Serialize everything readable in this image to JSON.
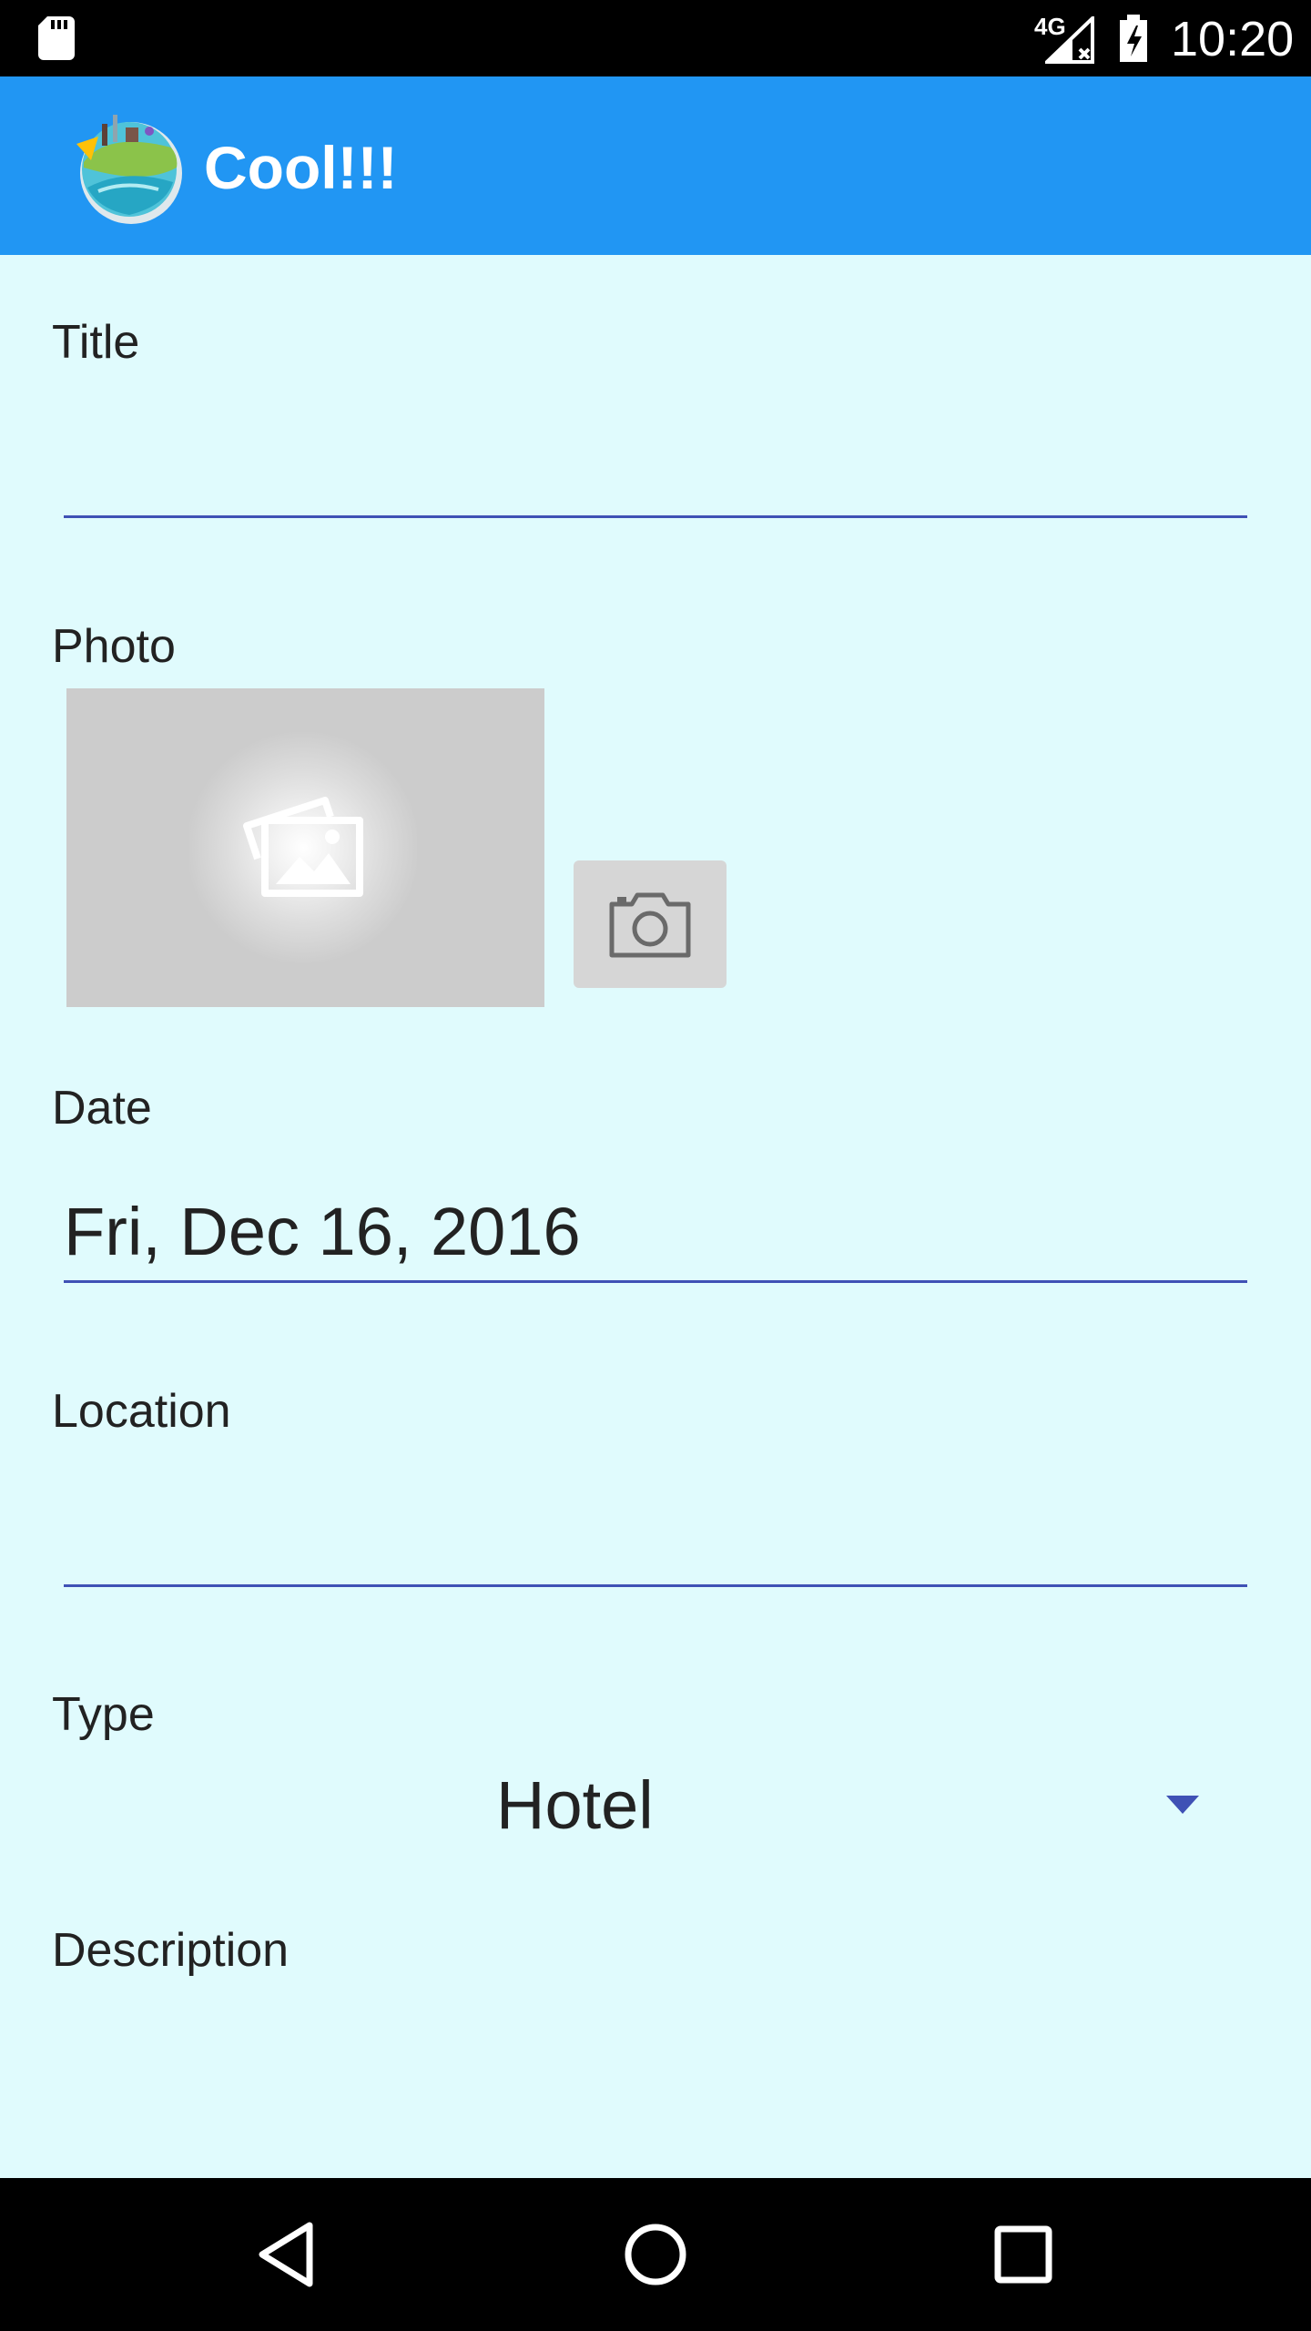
{
  "status_bar": {
    "network": "4G",
    "time": "10:20"
  },
  "app_bar": {
    "title": "Cool!!!"
  },
  "form": {
    "title_label": "Title",
    "title_value": "",
    "photo_label": "Photo",
    "date_label": "Date",
    "date_value": "Fri, Dec 16, 2016",
    "location_label": "Location",
    "location_value": "",
    "type_label": "Type",
    "type_value": "Hotel",
    "description_label": "Description"
  },
  "icons": {
    "sd_card": "sd-card-icon",
    "signal": "signal-icon",
    "battery": "battery-icon",
    "logo": "app-logo-icon",
    "photo_placeholder": "image-placeholder-icon",
    "camera": "camera-icon",
    "dropdown": "dropdown-arrow-icon",
    "back": "back-icon",
    "home": "home-icon",
    "recents": "recents-icon"
  },
  "colors": {
    "app_bar": "#2196f3",
    "background": "#e0fbfd",
    "accent_line": "#3f51b5"
  }
}
